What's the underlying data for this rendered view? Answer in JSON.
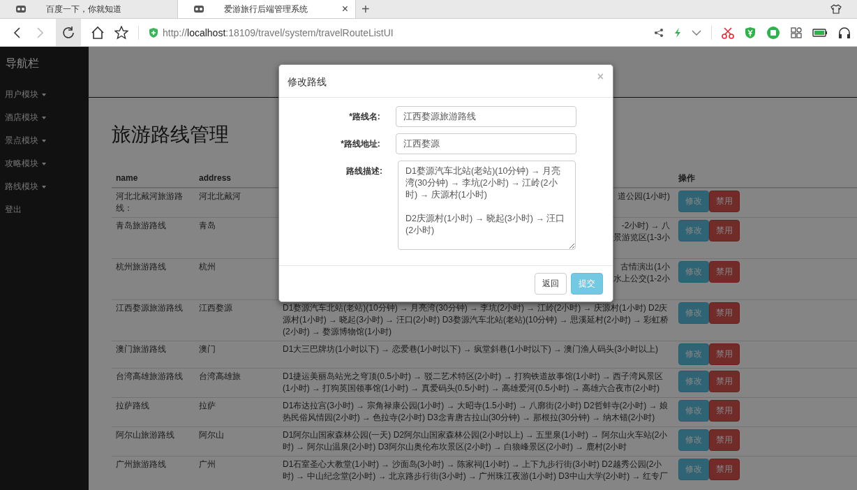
{
  "browser": {
    "tabs": [
      {
        "title": "百度一下，你就知道",
        "selected": false
      },
      {
        "title": "爱游旅行后端管理系统",
        "selected": true
      }
    ],
    "tab_close": "×",
    "new_tab": "+",
    "url": "http://**localhost**:18109/travel/system/travelRouteListUI"
  },
  "sidebar": {
    "title": "导航栏",
    "items": [
      {
        "label": "用户模块",
        "dropdown": true
      },
      {
        "label": "酒店模块",
        "dropdown": true
      },
      {
        "label": "景点模块",
        "dropdown": true
      },
      {
        "label": "攻略模块",
        "dropdown": true
      },
      {
        "label": "路线模块",
        "dropdown": true
      },
      {
        "label": "登出",
        "dropdown": false
      }
    ]
  },
  "page": {
    "title": "旅游路线管理"
  },
  "table": {
    "columns": [
      {
        "label": "name"
      },
      {
        "label": "address"
      },
      {},
      {
        "label": "操作"
      }
    ],
    "rows": [
      {
        "name": "河北北戴河旅游路线：",
        "address": "河北北戴河",
        "description_fragments": [
          "道公园(1小时)"
        ],
        "actions": [
          "修改",
          "禁用"
        ]
      },
      {
        "name": "青岛旅游路线",
        "address": "青岛",
        "description_fragments": [
          "-2小时) → 八",
          "景游览区(1-3小"
        ],
        "actions": [
          "修改",
          "禁用"
        ]
      },
      {
        "name": "杭州旅游路线",
        "address": "杭州",
        "description_fragments": [
          "古情演出(1小",
          "水上公交(1-2小"
        ],
        "actions": [
          "修改",
          "禁用"
        ]
      },
      {
        "name": "江西婺源旅游路线",
        "address": "江西婺源",
        "description": "D1婺源汽车北站(老站)(10分钟) → 月亮湾(30分钟) → 李坑(2小时) → 江岭(2小时) → 庆源村(1小时) D2庆源村(1小时) → 晓起(3小时) → 汪口(2小时) D3婺源汽车北站(老站)(10分钟) → 思溪延村(2小时) → 彩虹桥(2小时) → 婺源博物馆(1小时)",
        "actions": [
          "修改",
          "禁用"
        ]
      },
      {
        "name": "澳门旅游路线",
        "address": "澳门",
        "description": "D1大三巴牌坊(1小时以下) → 恋爱巷(1小时以下) → 疯堂斜巷(1小时以下) → 澳门渔人码头(3小时以上)",
        "actions": [
          "修改",
          "禁用"
        ]
      },
      {
        "name": "台湾高雄旅游路线",
        "address": "台湾高雄旅",
        "description": "D1捷运美丽岛站光之穹顶(0.5小时) → 驳二艺术特区(2小时) → 打狗铁道故事馆(1小时) → 西子湾风景区(1小时) → 打狗英国领事馆(1小时) → 真爱码头(0.5小时) → 高雄爱河(0.5小时) → 高雄六合夜市(2小时)",
        "actions": [
          "修改",
          "禁用"
        ]
      },
      {
        "name": "拉萨路线",
        "address": "拉萨",
        "description": "D1布达拉宫(3小时) → 宗角禄康公园(1小时) → 大昭寺(1.5小时) → 八廓街(2小时) D2哲蚌寺(2小时) → 娘热民俗风情园(2小时) → 色拉寺(2小时) D3念青唐古拉山(30分钟) → 那根拉(30分钟) → 纳木错(2小时)",
        "actions": [
          "修改",
          "禁用"
        ]
      },
      {
        "name": "阿尔山旅游路线",
        "address": "阿尔山",
        "description": "D1阿尔山国家森林公园(一天) D2阿尔山国家森林公园(2小时以上) → 五里泉(1小时) → 阿尔山火车站(2小时) → 阿尔山温泉(2小时) D3阿尔山奥伦布坎景区(2小时) → 白狼峰景区(2小时) → 鹿村(2小时",
        "actions": [
          "修改",
          "禁用"
        ]
      },
      {
        "name": "广州旅游路线",
        "address": "广州",
        "description": "D1石室圣心大教堂(1小时) → 沙面岛(3小时) → 陈家祠(1小时) → 上下九步行街(3小时) D2越秀公园(2小时) → 中山纪念堂(2小时) → 北京路步行街(3小时) → 广州珠江夜游(1小时) D3中山大学(2小时) → 红专厂",
        "actions": [
          "修改",
          "禁用"
        ]
      }
    ]
  },
  "modal": {
    "title": "修改路线",
    "close": "×",
    "fields": [
      {
        "kind": "input",
        "label": "*路线名:",
        "value": "江西婺源旅游路线"
      },
      {
        "kind": "input",
        "label": "*路线地址:",
        "value": "江西婺源"
      },
      {
        "kind": "textarea",
        "label": "路线描述:",
        "value": "D1婺源汽车北站(老站)(10分钟) → 月亮湾(30分钟) → 李坑(2小时) → 江岭(2小时) → 庆源村(1小时)\n\nD2庆源村(1小时) → 晓起(3小时) → 汪口(2小时)"
      }
    ],
    "buttons": [
      {
        "label": "返回",
        "kind": "default"
      },
      {
        "label": "提交",
        "kind": "primary"
      }
    ]
  }
}
